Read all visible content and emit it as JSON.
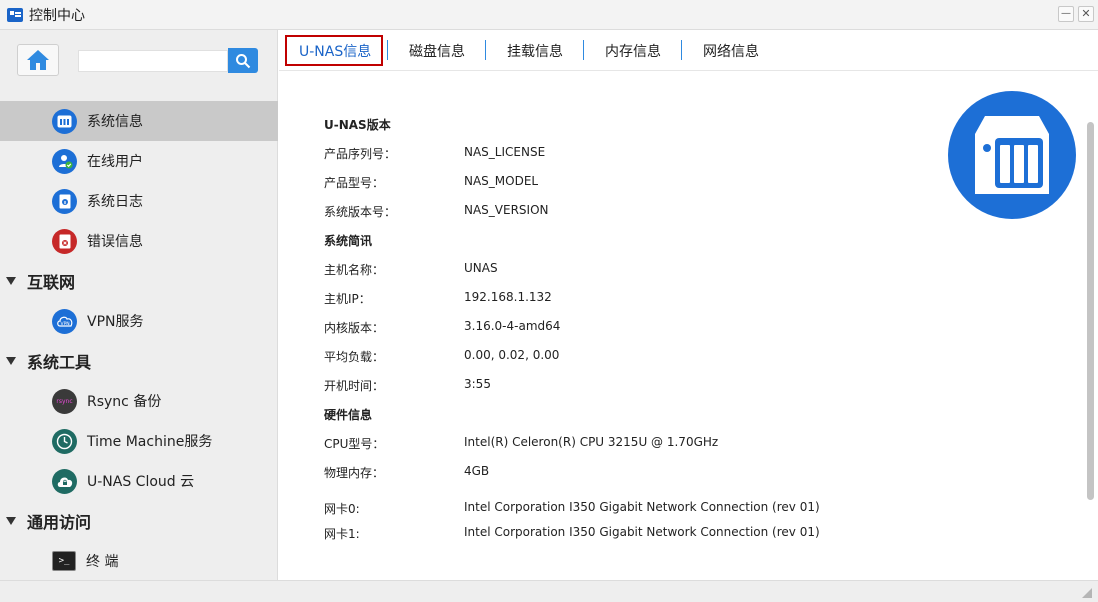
{
  "window": {
    "title": "控制中心",
    "minimize_glyph": "—",
    "close_glyph": "✕"
  },
  "sidebar": {
    "search": {
      "value": "",
      "placeholder": ""
    },
    "items": [
      {
        "label": "系统信息",
        "icon": "system-info-icon",
        "active": true
      },
      {
        "label": "在线用户",
        "icon": "online-user-icon"
      },
      {
        "label": "系统日志",
        "icon": "system-log-icon"
      },
      {
        "label": "错误信息",
        "icon": "error-info-icon"
      }
    ],
    "sections": [
      {
        "label": "互联网",
        "items": [
          {
            "label": "VPN服务",
            "icon": "vpn-icon"
          }
        ]
      },
      {
        "label": "系统工具",
        "items": [
          {
            "label": "Rsync 备份",
            "icon": "rsync-icon",
            "icon_text": "rsync"
          },
          {
            "label": "Time Machine服务",
            "icon": "time-machine-icon"
          },
          {
            "label": "U-NAS Cloud 云",
            "icon": "cloud-icon"
          }
        ]
      },
      {
        "label": "通用访问",
        "items": [
          {
            "label": "终 端",
            "icon": "terminal-icon",
            "icon_text": ">_"
          }
        ]
      }
    ]
  },
  "tabs": [
    {
      "label": "U-NAS信息",
      "active": true
    },
    {
      "label": "磁盘信息"
    },
    {
      "label": "挂载信息"
    },
    {
      "label": "内存信息"
    },
    {
      "label": "网络信息"
    }
  ],
  "info": {
    "version_heading": "U-NAS版本",
    "serial_label": "产品序列号：",
    "serial_value": "NAS_LICENSE",
    "model_label": "产品型号：",
    "model_value": "NAS_MODEL",
    "sysver_label": "系统版本号：",
    "sysver_value": "NAS_VERSION",
    "brief_heading": "系统简讯",
    "host_label": "主机名称：",
    "host_value": "UNAS",
    "ip_label": "主机IP：",
    "ip_value": "192.168.1.132",
    "kernel_label": "内核版本：",
    "kernel_value": "3.16.0-4-amd64",
    "load_label": "平均负载：",
    "load_value": "0.00, 0.02, 0.00",
    "uptime_label": "开机时间：",
    "uptime_value": "3:55",
    "hw_heading": "硬件信息",
    "cpu_label": "CPU型号：",
    "cpu_value": "Intel(R) Celeron(R) CPU 3215U @ 1.70GHz",
    "mem_label": "物理内存：",
    "mem_value": "4GB",
    "nic0_label": "网卡0:",
    "nic0_value": "Intel Corporation I350 Gigabit Network Connection (rev 01)",
    "nic1_label": "网卡1:",
    "nic1_value": "Intel Corporation I350 Gigabit Network Connection (rev 01)"
  },
  "colors": {
    "accent": "#2f8ae0",
    "active_tab_text": "#1a64c8",
    "highlight_border": "#c00000",
    "logo_blue": "#1d6fd6"
  }
}
